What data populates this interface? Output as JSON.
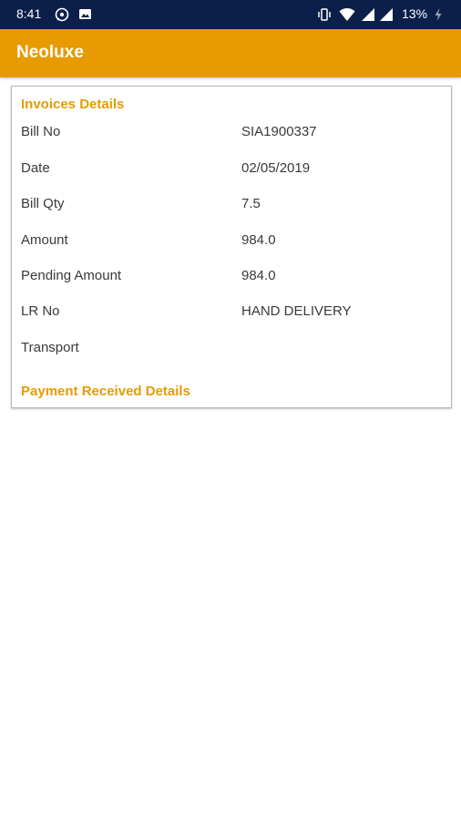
{
  "status_bar": {
    "time": "8:41",
    "battery": "13%",
    "icons": [
      "whatsapp-icon",
      "image-icon",
      "vibrate-icon",
      "wifi-icon",
      "signal-icon",
      "signal-icon",
      "charging-icon"
    ]
  },
  "app_bar": {
    "title": "Neoluxe",
    "background_color": "#e89b00"
  },
  "invoice": {
    "section_title": "Invoices Details",
    "rows": [
      {
        "label": "Bill No",
        "value": "SIA1900337"
      },
      {
        "label": "Date",
        "value": "02/05/2019"
      },
      {
        "label": "Bill Qty",
        "value": "7.5"
      },
      {
        "label": "Amount",
        "value": "984.0"
      },
      {
        "label": "Pending Amount",
        "value": "984.0"
      },
      {
        "label": "LR No",
        "value": "HAND DELIVERY"
      },
      {
        "label": "Transport",
        "value": ""
      }
    ]
  },
  "payment": {
    "section_title": "Payment Received Details"
  },
  "colors": {
    "status_bar": "#0c1f4a",
    "accent": "#e89b00",
    "text": "#3a3a3a"
  }
}
